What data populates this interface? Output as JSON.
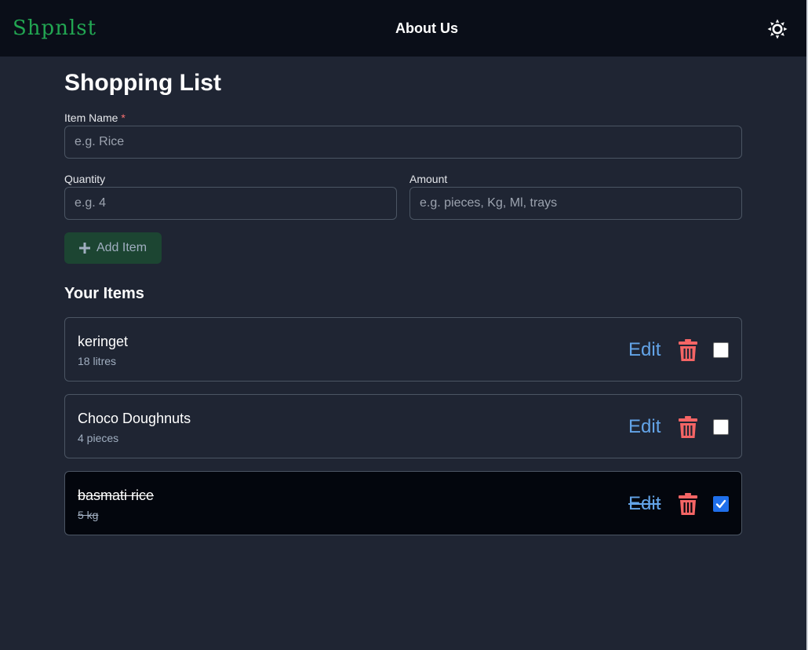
{
  "header": {
    "logo_text": "Shpnlst",
    "nav_about": "About Us",
    "theme_icon": "sun-icon"
  },
  "main": {
    "title": "Shopping List",
    "form": {
      "item_name_label": "Item Name",
      "item_name_required": "*",
      "item_name_placeholder": "e.g. Rice",
      "item_name_value": "",
      "quantity_label": "Quantity",
      "quantity_placeholder": "e.g. 4",
      "quantity_value": "",
      "amount_label": "Amount",
      "amount_placeholder": "e.g. pieces, Kg, Ml, trays",
      "amount_value": "",
      "add_button_label": "Add Item",
      "add_button_icon": "plus-icon"
    },
    "items_title": "Your Items",
    "items": [
      {
        "name": "keringet",
        "quantity": "18 litres",
        "edit_label": "Edit",
        "checked": false
      },
      {
        "name": "Choco Doughnuts",
        "quantity": "4 pieces",
        "edit_label": "Edit",
        "checked": false
      },
      {
        "name": "basmati rice",
        "quantity": "5 kg",
        "edit_label": "Edit",
        "checked": true
      }
    ]
  },
  "colors": {
    "page_bg": "#1f2533",
    "header_bg": "#0a0e18",
    "logo_green": "#22a652",
    "edit_blue": "#63a4e8",
    "delete_red": "#f56565",
    "add_button_bg": "#1c4532",
    "checked_blue": "#1f6feb"
  }
}
